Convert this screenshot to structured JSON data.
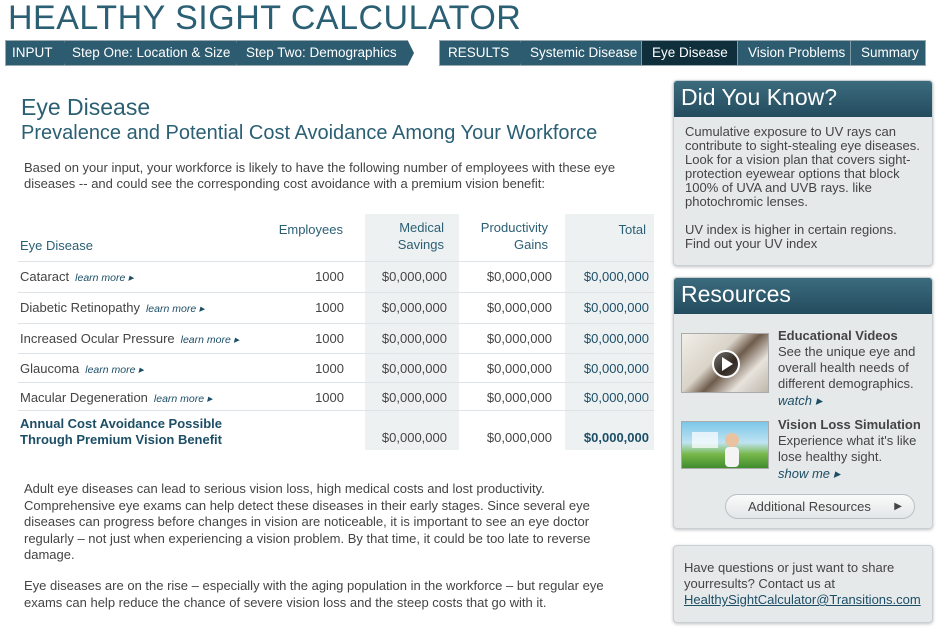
{
  "app": {
    "title": "HEALTHY SIGHT CALCULATOR"
  },
  "nav_input": {
    "label": "INPUT",
    "items": [
      "Step One: Location & Size",
      "Step Two: Demographics"
    ]
  },
  "nav_results": {
    "label": "RESULTS",
    "items": [
      "Systemic Disease",
      "Eye Disease",
      "Vision Problems",
      "Summary"
    ],
    "active": "Eye Disease"
  },
  "main": {
    "title": "Eye Disease",
    "subtitle": "Prevalence and Potential Cost Avoidance Among Your Workforce",
    "intro": "Based on your input, your workforce is likely to have the following number of employees with these eye diseases -- and could see the corresponding cost avoidance with a premium vision benefit:",
    "table": {
      "headers": {
        "disease": "Eye Disease",
        "employees": "Employees",
        "medical_line1": "Medical",
        "medical_line2": "Savings",
        "productivity_line1": "Productivity",
        "productivity_line2": "Gains",
        "total": "Total"
      },
      "learn_more": "learn more ▸",
      "rows": [
        {
          "disease": "Cataract",
          "employees": "1000",
          "medical": "$0,000,000",
          "productivity": "$0,000,000",
          "total": "$0,000,000"
        },
        {
          "disease": "Diabetic Retinopathy",
          "employees": "1000",
          "medical": "$0,000,000",
          "productivity": "$0,000,000",
          "total": "$0,000,000"
        },
        {
          "disease": "Increased Ocular Pressure",
          "employees": "1000",
          "medical": "$0,000,000",
          "productivity": "$0,000,000",
          "total": "$0,000,000"
        },
        {
          "disease": "Glaucoma",
          "employees": "1000",
          "medical": "$0,000,000",
          "productivity": "$0,000,000",
          "total": "$0,000,000"
        },
        {
          "disease": "Macular Degeneration",
          "employees": "1000",
          "medical": "$0,000,000",
          "productivity": "$0,000,000",
          "total": "$0,000,000"
        }
      ],
      "summary": {
        "label_line1": "Annual Cost Avoidance Possible",
        "label_line2": "Through Premium Vision Benefit",
        "medical": "$0,000,000",
        "productivity": "$0,000,000",
        "total": "$0,000,000"
      }
    },
    "para1": "Adult eye diseases can lead to serious vision loss, high medical costs and lost productivity. Comprehensive eye exams can help detect these diseases in their early stages. Since several eye diseases can progress before changes in vision are noticeable, it is important to see an eye doctor regularly – not just when experiencing a vision problem. By that time, it could be too late to reverse damage.",
    "para2": "Eye diseases are on the rise – especially with the aging population in the workforce – but regular eye exams can help reduce the chance of severe vision loss and the steep costs that go with it."
  },
  "did_you_know": {
    "title": "Did You Know?",
    "text": "Cumulative exposure to UV rays can contribute to  sight-stealing eye diseases. Look for a vision plan that covers sight-protection eyewear options that block 100% of UVA and UVB rays. like photochromic lenses.",
    "text2": "UV index is higher in certain regions. Find out your UV index"
  },
  "resources": {
    "title": "Resources",
    "items": [
      {
        "title": "Educational Videos",
        "desc": "See the unique eye and overall health needs of different demographics.",
        "link": "watch ▸"
      },
      {
        "title": "Vision Loss Simulation",
        "desc": "Experience what it's like lose healthy sight.",
        "link": "show me ▸"
      }
    ],
    "button": "Additional Resources",
    "button_icon": "▶"
  },
  "contact": {
    "text": "Have questions or just want to share yourresults? Contact us at",
    "email": "HealthySightCalculator@Transitions.com"
  }
}
